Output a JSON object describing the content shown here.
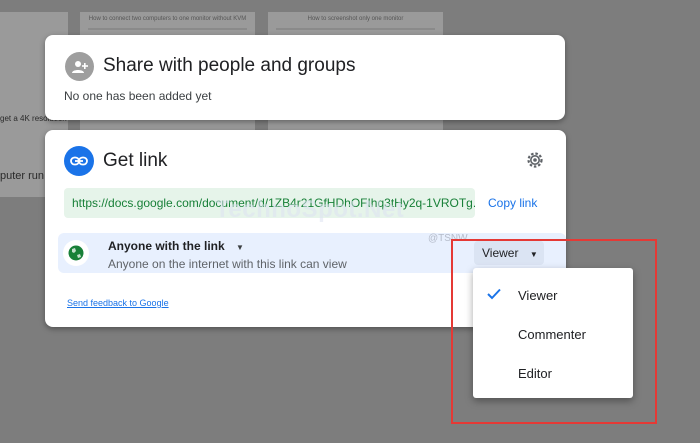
{
  "background": {
    "doc_titles": [
      "How to connect two computers to one monitor without KVM",
      "How to screenshot only one monitor"
    ],
    "left_fragments": [
      "get a 4K resolution",
      "puter run"
    ]
  },
  "share_panel": {
    "title": "Share with people and groups",
    "subtitle": "No one has been added yet",
    "icon": "add-person-icon"
  },
  "link_panel": {
    "title": "Get link",
    "url": "https://docs.google.com/document/d/1ZB4r21GfHDhOFIhq3tHy2q-1VROTg...",
    "copy_label": "Copy link",
    "access_title": "Anyone with the link",
    "access_subtitle": "Anyone on the internet with this link can view",
    "role_button": "Viewer",
    "feedback": "Send feedback to Google"
  },
  "watermark": {
    "text": "TechnoSpot.Net",
    "tag": "@TSNW"
  },
  "role_menu": {
    "items": [
      {
        "label": "Viewer",
        "selected": true
      },
      {
        "label": "Commenter",
        "selected": false
      },
      {
        "label": "Editor",
        "selected": false
      }
    ]
  },
  "colors": {
    "accent": "#1a73e8",
    "url_green": "#188038",
    "url_bg": "#e6f4ea",
    "highlight_box": "#e53935"
  }
}
